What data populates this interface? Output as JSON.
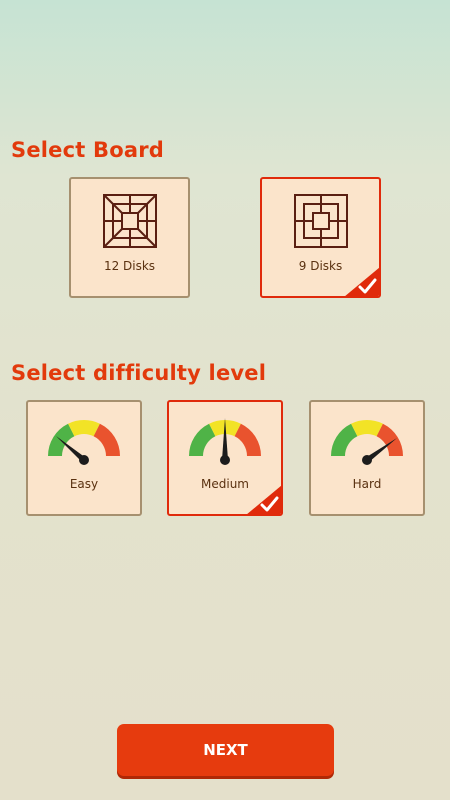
{
  "board_section": {
    "title": "Select Board",
    "options": [
      {
        "label": "12 Disks",
        "selected": false
      },
      {
        "label": "9 Disks",
        "selected": true
      }
    ]
  },
  "difficulty_section": {
    "title": "Select difficulty level",
    "options": [
      {
        "label": "Easy",
        "selected": false
      },
      {
        "label": "Medium",
        "selected": true
      },
      {
        "label": "Hard",
        "selected": false
      }
    ]
  },
  "next_button": {
    "label": "NEXT"
  },
  "colors": {
    "accent": "#e23a0c",
    "card_bg": "#fbe4cb",
    "card_border": "#a6906f",
    "gauge_green": "#4fb347",
    "gauge_yellow": "#f2e326",
    "gauge_red": "#e9532e"
  },
  "icons": {
    "board_12": "board-12-disks-icon",
    "board_9": "board-9-disks-icon",
    "check": "check-icon",
    "gauge": "gauge-icon"
  }
}
